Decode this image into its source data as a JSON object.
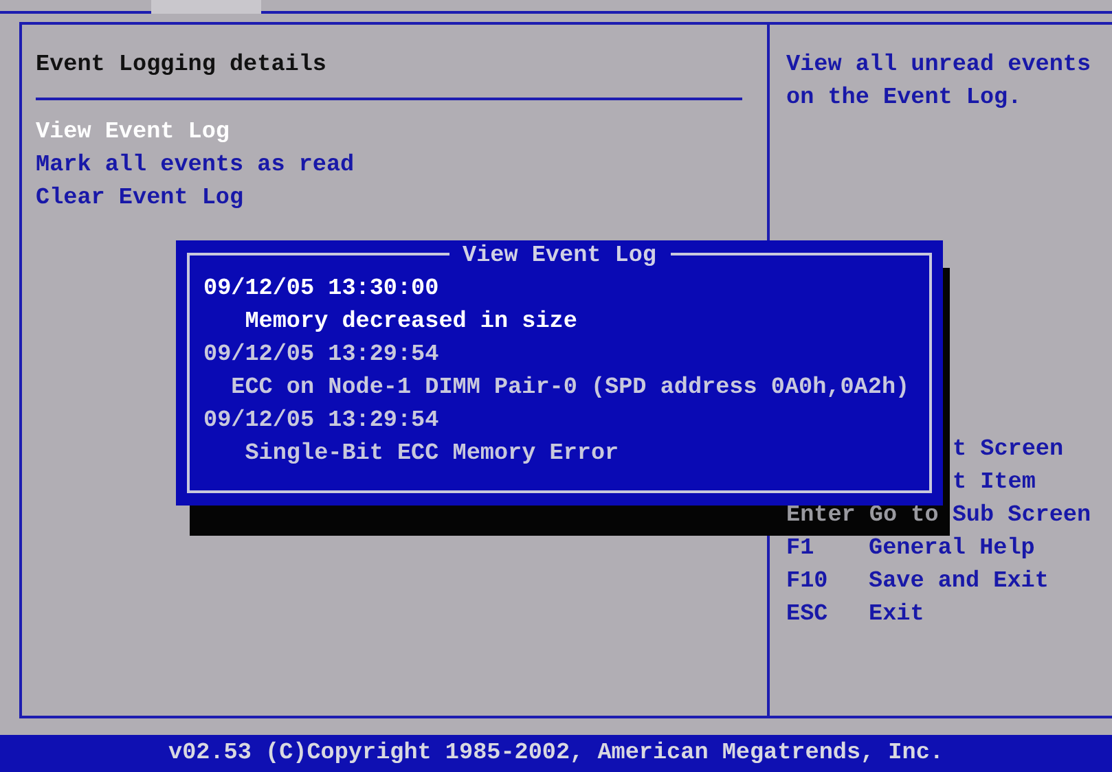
{
  "panel": {
    "title": "Event Logging details",
    "items": [
      {
        "label": "View Event Log",
        "selected": true
      },
      {
        "label": "Mark all events as read",
        "selected": false
      },
      {
        "label": "Clear Event Log",
        "selected": false
      }
    ]
  },
  "help": {
    "description": "View all unread events on the Event Log.",
    "keys": [
      {
        "kind": "clipped",
        "text": "t Screen"
      },
      {
        "kind": "clipped",
        "text": "t Item"
      },
      {
        "kind": "shadowed",
        "shadowed_text": "Enter Go to",
        "text": "Sub Screen"
      },
      {
        "kind": "key",
        "key": "F1",
        "text": "General Help"
      },
      {
        "kind": "key",
        "key": "F10",
        "text": "Save and Exit"
      },
      {
        "kind": "key",
        "key": "ESC",
        "text": "Exit"
      }
    ]
  },
  "dialog": {
    "title": "View Event Log",
    "entries": [
      {
        "time": "09/12/05 13:30:00",
        "message": "   Memory decreased in size",
        "selected": true
      },
      {
        "time": "09/12/05 13:29:54",
        "message": "  ECC on Node-1 DIMM Pair-0 (SPD address 0A0h,0A2h)",
        "selected": false
      },
      {
        "time": "09/12/05 13:29:54",
        "message": "   Single-Bit ECC Memory Error",
        "selected": false
      }
    ]
  },
  "footer": "v02.53 (C)Copyright 1985-2002, American Megatrends, Inc."
}
